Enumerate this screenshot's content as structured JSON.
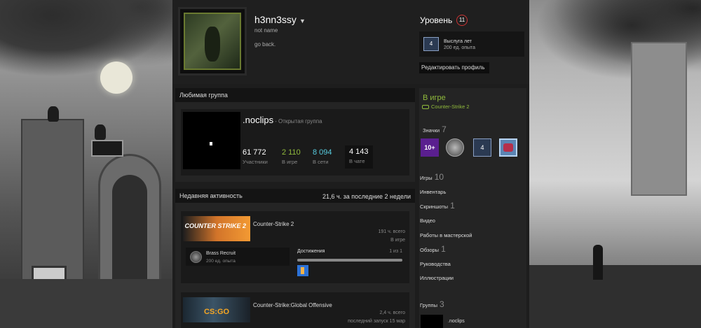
{
  "profile": {
    "username": "h3nn3ssy",
    "caret": "▼",
    "real_name": "not name",
    "summary": "go back."
  },
  "favorite_group": {
    "header": "Любимая группа",
    "name": ".noclips",
    "type": "- Открытая группа",
    "stats": [
      {
        "value": "61 772",
        "label": "Участники",
        "color": "#ffffff"
      },
      {
        "value": "2 110",
        "label": "В игре",
        "color": "#90ba3c"
      },
      {
        "value": "8 094",
        "label": "В сети",
        "color": "#57cbde"
      },
      {
        "value": "4 143",
        "label": "В чате",
        "color": "#ffffff"
      }
    ]
  },
  "activity": {
    "header": "Недавняя активность",
    "hours_recent": "21,6 ч. за последние 2 недели",
    "games": [
      {
        "name": "Counter-Strike 2",
        "logo": "COUNTER STRIKE 2",
        "hours": "191 ч. всего",
        "state": "В игре",
        "badge_name": "Brass Recruit",
        "badge_xp": "200 ед. опыта",
        "achievements_label": "Достижения",
        "achievements_count": "1 из 1",
        "achievements_progress": 1.0
      },
      {
        "name": "Counter-Strike:Global Offensive",
        "logo": "CS:GO",
        "hours": "2,4 ч. всего",
        "state": "последний запуск 15 мар"
      }
    ]
  },
  "sidebar": {
    "level_label": "Уровень",
    "level": "11",
    "service_badge_value": "4",
    "service_title": "Выслуга лет",
    "service_xp": "200 ед. опыта",
    "edit_profile": "Редактировать профиль",
    "status": "В игре",
    "status_game": "Counter-Strike 2",
    "badges_label": "Значки",
    "badges_count": "7",
    "badge_items": [
      "10+",
      "",
      "4",
      ""
    ],
    "links": [
      {
        "label": "Игры",
        "count": "10"
      },
      {
        "label": "Инвентарь",
        "count": ""
      },
      {
        "label": "Скриншоты",
        "count": "1"
      },
      {
        "label": "Видео",
        "count": ""
      },
      {
        "label": "Работы в мастерской",
        "count": ""
      },
      {
        "label": "Обзоры",
        "count": "1"
      },
      {
        "label": "Руководства",
        "count": ""
      },
      {
        "label": "Иллюстрации",
        "count": ""
      }
    ],
    "groups_label": "Группы",
    "groups_count": "3",
    "group_name": ".noclips"
  }
}
